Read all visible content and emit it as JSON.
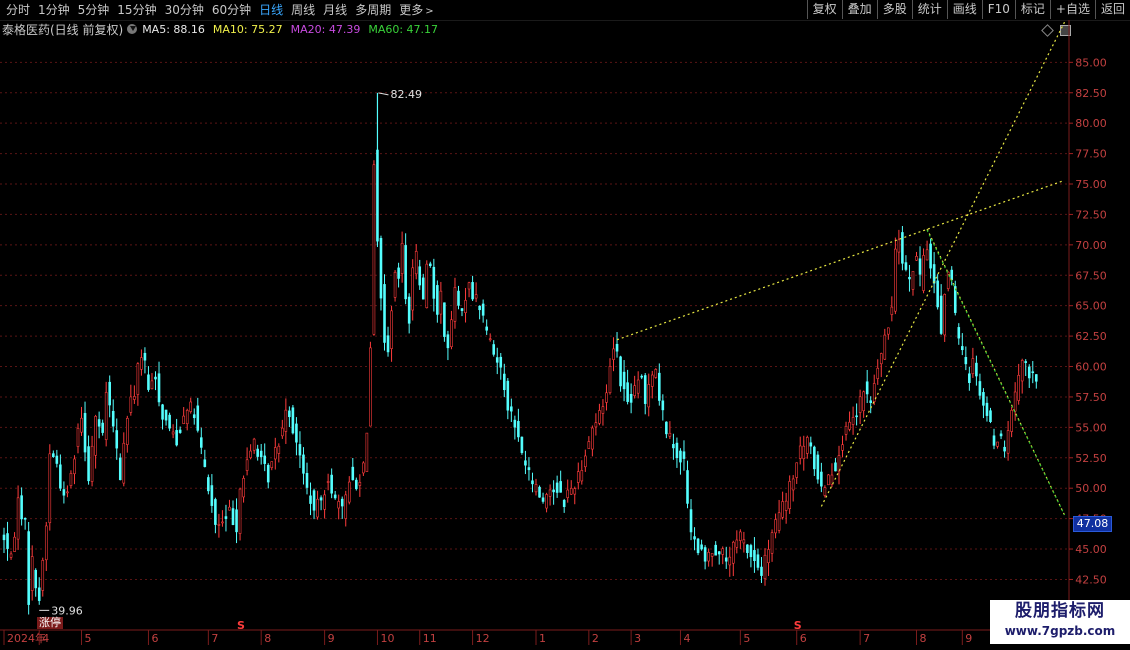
{
  "toolbar": {
    "tabs": [
      {
        "label": "分时"
      },
      {
        "label": "1分钟"
      },
      {
        "label": "5分钟"
      },
      {
        "label": "15分钟"
      },
      {
        "label": "30分钟"
      },
      {
        "label": "60分钟"
      },
      {
        "label": "日线",
        "active": true
      },
      {
        "label": "周线"
      },
      {
        "label": "月线"
      },
      {
        "label": "多周期"
      },
      {
        "label": "更多"
      }
    ],
    "tools": [
      {
        "label": "复权"
      },
      {
        "label": "叠加"
      },
      {
        "label": "多股"
      },
      {
        "label": "统计"
      },
      {
        "label": "画线"
      },
      {
        "label": "F10"
      },
      {
        "label": "标记"
      },
      {
        "label": "+自选"
      },
      {
        "label": "返回"
      }
    ]
  },
  "info": {
    "title": "泰格医药(日线 前复权)",
    "ma5": "MA5: 88.16",
    "ma10": "MA10: 75.27",
    "ma20": "MA20: 47.39",
    "ma60": "MA60: 47.17"
  },
  "chart_data": {
    "type": "candlestick",
    "y_ticks": [
      42.5,
      45.0,
      47.5,
      50.0,
      52.5,
      55.0,
      57.5,
      60.0,
      62.5,
      65.0,
      67.5,
      70.0,
      72.5,
      75.0,
      77.5,
      80.0,
      82.5,
      85.0
    ],
    "y_tick_labels": [
      "42.50",
      "45.00",
      "47.50",
      "50.00",
      "52.50",
      "55.00",
      "57.50",
      "60.00",
      "62.50",
      "65.00",
      "67.50",
      "70.00",
      "72.50",
      "75.00",
      "77.50",
      "80.00",
      "82.50",
      "85.00"
    ],
    "ylim": [
      40.4,
      87.0
    ],
    "x_labels": [
      {
        "label": "2024年",
        "day": 0
      },
      {
        "label": "4",
        "day": 10
      },
      {
        "label": "5",
        "day": 22
      },
      {
        "label": "6",
        "day": 41
      },
      {
        "label": "7",
        "day": 58
      },
      {
        "label": "8",
        "day": 73
      },
      {
        "label": "9",
        "day": 91
      },
      {
        "label": "10",
        "day": 106
      },
      {
        "label": "11",
        "day": 118
      },
      {
        "label": "12",
        "day": 133
      },
      {
        "label": "1",
        "day": 151
      },
      {
        "label": "2",
        "day": 166
      },
      {
        "label": "3",
        "day": 178
      },
      {
        "label": "4",
        "day": 192
      },
      {
        "label": "5",
        "day": 209
      },
      {
        "label": "6",
        "day": 225
      },
      {
        "label": "7",
        "day": 243
      },
      {
        "label": "8",
        "day": 259
      },
      {
        "label": "9",
        "day": 272
      }
    ],
    "high_annotation": {
      "label": "82.49",
      "value": 82.49,
      "day": 106
    },
    "low_annotation": {
      "label": "39.96",
      "value": 39.96,
      "day": 10
    },
    "s_markers": [
      {
        "label": "S",
        "day": 67
      },
      {
        "label": "S",
        "day": 225
      }
    ],
    "last_price": {
      "label": "47.08",
      "value": 47.08
    },
    "trendlines": [
      {
        "from": {
          "day": 174,
          "value": 62.2
        },
        "to": {
          "day": 301,
          "value": 75.3
        },
        "color": "#e8e842"
      },
      {
        "from": {
          "day": 232,
          "value": 48.5
        },
        "to": {
          "day": 301,
          "value": 88.3
        },
        "color": "#e8e842"
      },
      {
        "from": {
          "day": 262,
          "value": 71.3
        },
        "to": {
          "day": 301,
          "value": 47.8
        },
        "color": "#e8e842"
      },
      {
        "from": {
          "day": 262,
          "value": 71.2
        },
        "to": {
          "day": 301,
          "value": 47.8
        },
        "color": "#2ec02e"
      }
    ],
    "closes": [
      [
        0,
        46
      ],
      [
        2,
        44
      ],
      [
        4,
        49
      ],
      [
        6,
        47
      ],
      [
        7,
        41
      ],
      [
        8,
        44
      ],
      [
        9,
        42
      ],
      [
        10,
        41
      ],
      [
        11,
        44
      ],
      [
        12,
        47
      ],
      [
        13,
        53
      ],
      [
        15,
        52
      ],
      [
        17,
        49
      ],
      [
        19,
        51
      ],
      [
        21,
        55
      ],
      [
        22,
        56
      ],
      [
        24,
        51
      ],
      [
        26,
        56
      ],
      [
        28,
        54
      ],
      [
        29,
        58
      ],
      [
        31,
        55
      ],
      [
        33,
        51
      ],
      [
        35,
        56
      ],
      [
        37,
        58
      ],
      [
        38,
        60
      ],
      [
        39,
        61
      ],
      [
        40,
        60
      ],
      [
        41,
        58
      ],
      [
        43,
        59
      ],
      [
        45,
        56
      ],
      [
        47,
        55
      ],
      [
        49,
        54
      ],
      [
        51,
        56
      ],
      [
        52,
        57
      ],
      [
        54,
        56
      ],
      [
        56,
        53
      ],
      [
        58,
        50
      ],
      [
        60,
        47
      ],
      [
        62,
        47
      ],
      [
        64,
        48
      ],
      [
        66,
        47
      ],
      [
        67,
        50
      ],
      [
        69,
        52
      ],
      [
        71,
        54
      ],
      [
        73,
        52
      ],
      [
        75,
        51
      ],
      [
        77,
        53
      ],
      [
        79,
        55
      ],
      [
        80,
        57
      ],
      [
        81,
        56
      ],
      [
        83,
        54
      ],
      [
        85,
        51
      ],
      [
        87,
        49
      ],
      [
        88,
        48
      ],
      [
        90,
        49
      ],
      [
        92,
        51
      ],
      [
        94,
        49
      ],
      [
        96,
        48
      ],
      [
        98,
        51
      ],
      [
        100,
        50
      ],
      [
        102,
        52
      ],
      [
        103,
        55
      ],
      [
        104,
        62
      ],
      [
        105,
        77
      ],
      [
        106,
        70
      ],
      [
        107,
        66
      ],
      [
        108,
        62
      ],
      [
        109,
        61
      ],
      [
        110,
        65
      ],
      [
        111,
        68
      ],
      [
        112,
        67
      ],
      [
        113,
        70
      ],
      [
        114,
        66
      ],
      [
        115,
        64
      ],
      [
        116,
        68
      ],
      [
        117,
        69
      ],
      [
        118,
        67
      ],
      [
        119,
        65
      ],
      [
        120,
        69
      ],
      [
        121,
        68
      ],
      [
        122,
        66
      ],
      [
        123,
        64
      ],
      [
        124,
        66
      ],
      [
        125,
        63
      ],
      [
        126,
        61
      ],
      [
        127,
        64
      ],
      [
        128,
        66
      ],
      [
        129,
        65
      ],
      [
        130,
        64
      ],
      [
        131,
        66
      ],
      [
        132,
        67
      ],
      [
        133,
        66
      ],
      [
        135,
        65
      ],
      [
        137,
        63
      ],
      [
        139,
        61
      ],
      [
        141,
        60
      ],
      [
        143,
        57
      ],
      [
        145,
        55
      ],
      [
        147,
        53
      ],
      [
        149,
        51
      ],
      [
        151,
        50
      ],
      [
        153,
        49
      ],
      [
        155,
        50
      ],
      [
        157,
        50
      ],
      [
        159,
        49
      ],
      [
        161,
        50
      ],
      [
        163,
        51
      ],
      [
        165,
        53
      ],
      [
        167,
        55
      ],
      [
        169,
        56
      ],
      [
        171,
        58
      ],
      [
        172,
        60
      ],
      [
        173,
        62
      ],
      [
        174,
        61
      ],
      [
        175,
        59
      ],
      [
        176,
        58
      ],
      [
        177,
        57
      ],
      [
        179,
        58
      ],
      [
        181,
        59
      ],
      [
        182,
        57
      ],
      [
        183,
        59
      ],
      [
        185,
        60
      ],
      [
        186,
        57
      ],
      [
        187,
        56
      ],
      [
        189,
        54
      ],
      [
        191,
        53
      ],
      [
        193,
        52
      ],
      [
        194,
        49
      ],
      [
        195,
        46
      ],
      [
        197,
        45
      ],
      [
        199,
        44
      ],
      [
        201,
        45
      ],
      [
        203,
        45
      ],
      [
        205,
        44
      ],
      [
        207,
        45
      ],
      [
        209,
        46
      ],
      [
        211,
        45
      ],
      [
        213,
        44
      ],
      [
        215,
        43
      ],
      [
        216,
        44
      ],
      [
        218,
        46
      ],
      [
        220,
        48
      ],
      [
        222,
        49
      ],
      [
        224,
        51
      ],
      [
        226,
        53
      ],
      [
        228,
        54
      ],
      [
        230,
        52
      ],
      [
        232,
        50
      ],
      [
        234,
        51
      ],
      [
        236,
        52
      ],
      [
        238,
        54
      ],
      [
        240,
        55
      ],
      [
        242,
        56
      ],
      [
        244,
        58
      ],
      [
        246,
        57
      ],
      [
        248,
        60
      ],
      [
        250,
        62
      ],
      [
        252,
        65
      ],
      [
        253,
        70
      ],
      [
        254,
        71
      ],
      [
        255,
        69
      ],
      [
        256,
        68
      ],
      [
        257,
        67
      ],
      [
        258,
        68
      ],
      [
        259,
        69
      ],
      [
        260,
        67
      ],
      [
        261,
        69
      ],
      [
        262,
        70
      ],
      [
        263,
        68
      ],
      [
        264,
        67
      ],
      [
        265,
        65
      ],
      [
        266,
        63
      ],
      [
        267,
        66
      ],
      [
        268,
        68
      ],
      [
        269,
        67
      ],
      [
        270,
        64
      ],
      [
        271,
        62
      ],
      [
        272,
        61
      ],
      [
        273,
        60
      ],
      [
        274,
        59
      ],
      [
        275,
        61
      ],
      [
        276,
        59
      ],
      [
        277,
        58
      ],
      [
        278,
        57
      ],
      [
        279,
        56
      ],
      [
        280,
        55
      ],
      [
        281,
        54
      ],
      [
        282,
        54
      ],
      [
        283,
        54
      ],
      [
        284,
        53
      ],
      [
        285,
        55
      ],
      [
        286,
        56
      ],
      [
        287,
        58
      ],
      [
        288,
        59
      ],
      [
        289,
        60
      ],
      [
        290,
        60
      ],
      [
        291,
        59
      ],
      [
        292,
        60
      ],
      [
        293,
        59
      ]
    ]
  },
  "watermark": {
    "line1": "股朋指标网",
    "line2": "www.7gpzb.com"
  },
  "zhangting_label": "涨停"
}
